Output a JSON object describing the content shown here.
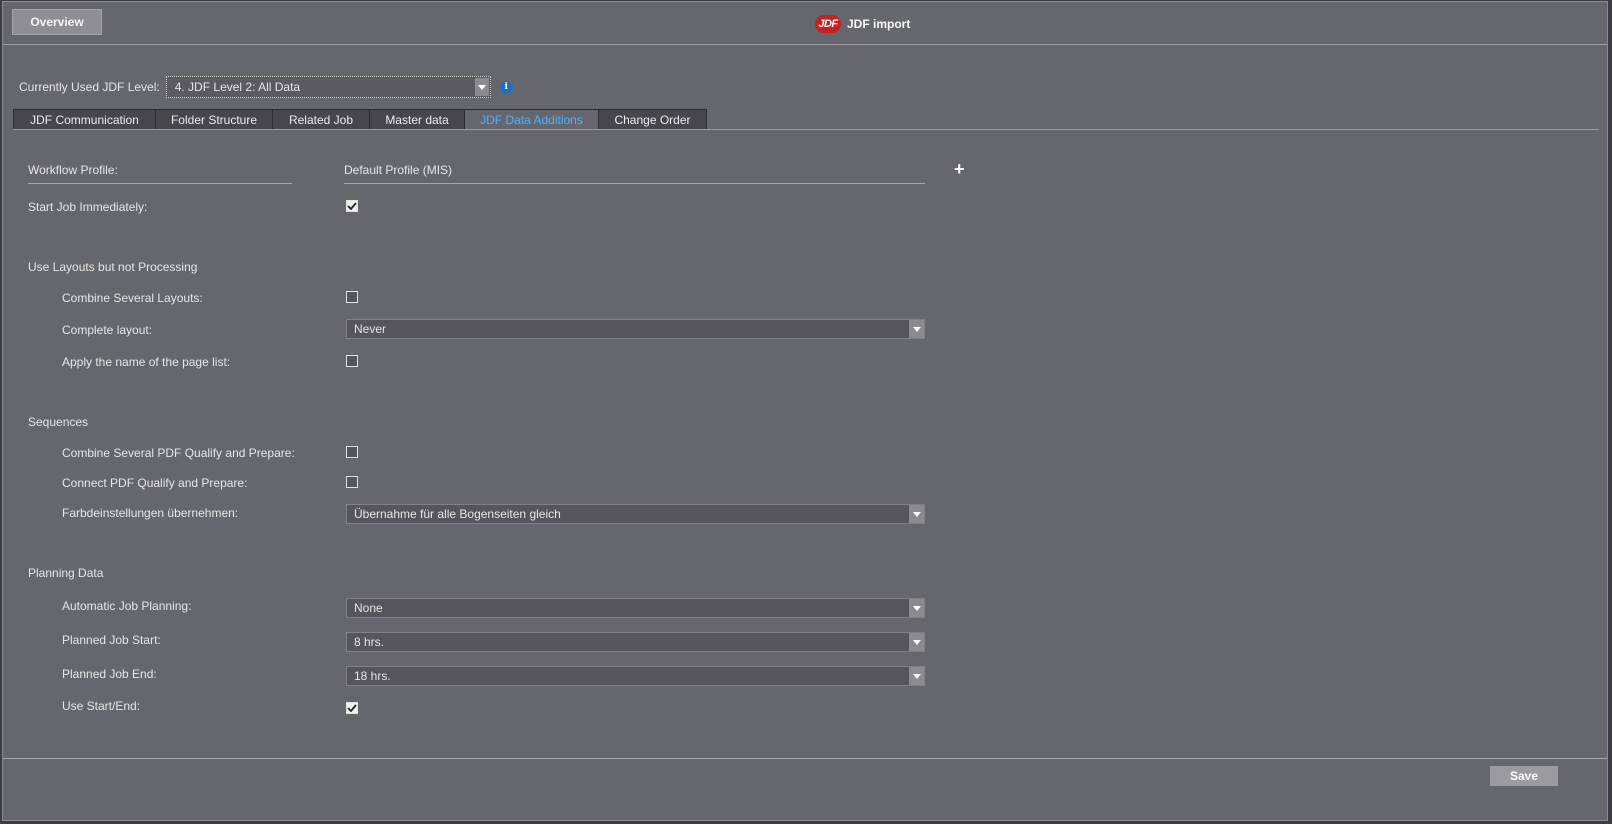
{
  "header": {
    "overview_label": "Overview",
    "logo_text": "JDF",
    "title": "JDF import"
  },
  "level": {
    "label": "Currently Used JDF Level:",
    "value": "4. JDF Level 2: All Data",
    "info_icon": "i"
  },
  "tabs": [
    {
      "label": "JDF Communication"
    },
    {
      "label": "Folder Structure"
    },
    {
      "label": "Related Job"
    },
    {
      "label": "Master data"
    },
    {
      "label": "JDF Data Additions",
      "active": true
    },
    {
      "label": "Change Order"
    }
  ],
  "form": {
    "workflow_profile_label": "Workflow Profile:",
    "workflow_profile_value": "Default Profile (MIS)",
    "add_icon": "+",
    "start_job_label": "Start Job Immediately:",
    "start_job_checked": true,
    "layouts_section": "Use Layouts but not Processing",
    "combine_layouts_label": "Combine Several Layouts:",
    "combine_layouts_checked": false,
    "complete_layout_label": "Complete layout:",
    "complete_layout_value": "Never",
    "apply_pagelist_label": "Apply the name of the page list:",
    "apply_pagelist_checked": false,
    "sequences_section": "Sequences",
    "combine_pdf_label": "Combine Several PDF Qualify and Prepare:",
    "combine_pdf_checked": false,
    "connect_pdf_label": "Connect PDF Qualify and Prepare:",
    "connect_pdf_checked": false,
    "farb_label": "Farbdeinstellungen übernehmen:",
    "farb_value": "Übernahme für alle Bogenseiten gleich",
    "planning_section": "Planning Data",
    "auto_planning_label": "Automatic Job Planning:",
    "auto_planning_value": "None",
    "job_start_label": "Planned Job Start:",
    "job_start_value": "8 hrs.",
    "job_end_label": "Planned Job End:",
    "job_end_value": "18 hrs.",
    "use_startend_label": "Use Start/End:",
    "use_startend_checked": true
  },
  "footer": {
    "save_label": "Save"
  },
  "colors": {
    "background": "#66666e",
    "active_tab_text": "#4fb0ff",
    "logo_red": "#c8201e",
    "info_blue": "#1d6fc2"
  }
}
